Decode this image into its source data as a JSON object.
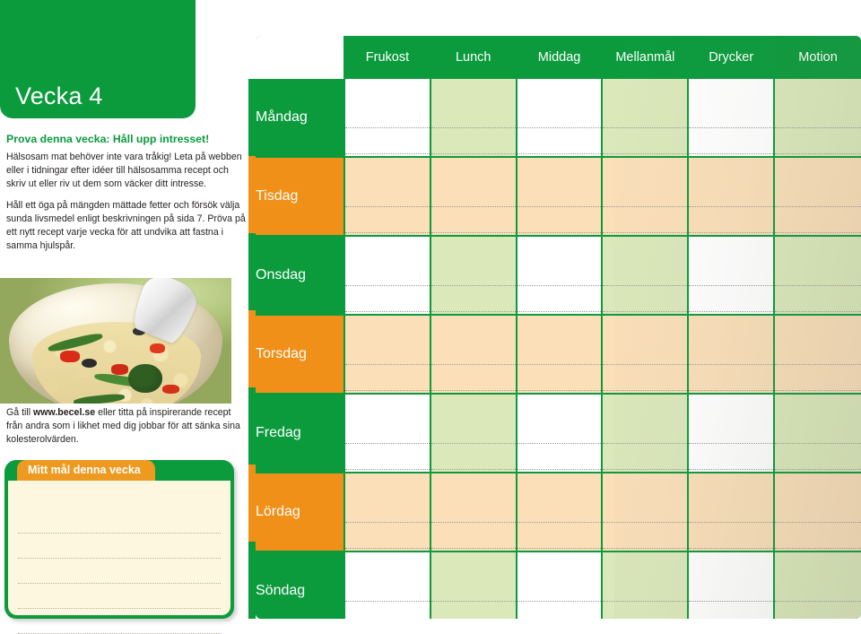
{
  "left": {
    "week_badge": "Vecka 4",
    "tip_heading": "Prova denna vecka: Håll upp intresset!",
    "paragraphs": [
      "Hälsosam mat behöver inte vara tråkig! Leta på webben eller i tidningar efter idéer till hälsosamma recept och skriv ut eller riv ut dem som väcker ditt intresse.",
      "Håll ett öga på mängden mättade fetter och försök välja sunda livsmedel enligt beskrivningen på sida 7. Pröva på ett nytt recept varje vecka för att undvika att fastna i samma hjulspår."
    ],
    "link_paragraph": {
      "before": "Gå till ",
      "link": "www.becel.se",
      "after": " eller titta på inspirerande recept från andra som i likhet med dig jobbar för att sänka sina kolesterolvärden."
    },
    "photo_alt": "couscous-salad-photo",
    "goal_box": {
      "tab_label": "Mitt mål denna vecka",
      "line_count": 5
    }
  },
  "planner": {
    "corner_label": "",
    "columns": [
      "Frukost",
      "Lunch",
      "Middag",
      "Mellanmål",
      "Drycker",
      "Motion"
    ],
    "rows": [
      {
        "day": "Måndag",
        "accent": "green",
        "cell_tints": [
          "white",
          "green",
          "white",
          "green",
          "white",
          "green"
        ]
      },
      {
        "day": "Tisdag",
        "accent": "orange",
        "cell_tints": [
          "orange",
          "orange",
          "orange",
          "orange",
          "orange",
          "orange"
        ]
      },
      {
        "day": "Onsdag",
        "accent": "green",
        "cell_tints": [
          "white",
          "green",
          "white",
          "green",
          "white",
          "green"
        ]
      },
      {
        "day": "Torsdag",
        "accent": "orange",
        "cell_tints": [
          "orange",
          "orange",
          "orange",
          "orange",
          "orange",
          "orange"
        ]
      },
      {
        "day": "Fredag",
        "accent": "green",
        "cell_tints": [
          "white",
          "green",
          "white",
          "green",
          "white",
          "green"
        ]
      },
      {
        "day": "Lördag",
        "accent": "orange",
        "cell_tints": [
          "orange",
          "orange",
          "orange",
          "orange",
          "orange",
          "orange"
        ]
      },
      {
        "day": "Söndag",
        "accent": "green",
        "cell_tints": [
          "white",
          "green",
          "white",
          "green",
          "white",
          "green"
        ]
      }
    ],
    "rules_per_cell": 2
  },
  "side_strip": [
    "green",
    "orange",
    "green",
    "orange",
    "green",
    "orange",
    "green"
  ],
  "colors": {
    "brand_green": "#0b9b3d",
    "brand_orange": "#f09018",
    "tab_orange": "#ee9a20",
    "tint_light_green": "#dbe8ba",
    "tint_light_orange": "#fadfb9",
    "goal_cream": "#fdf7e0",
    "text_dark": "#231f20"
  }
}
